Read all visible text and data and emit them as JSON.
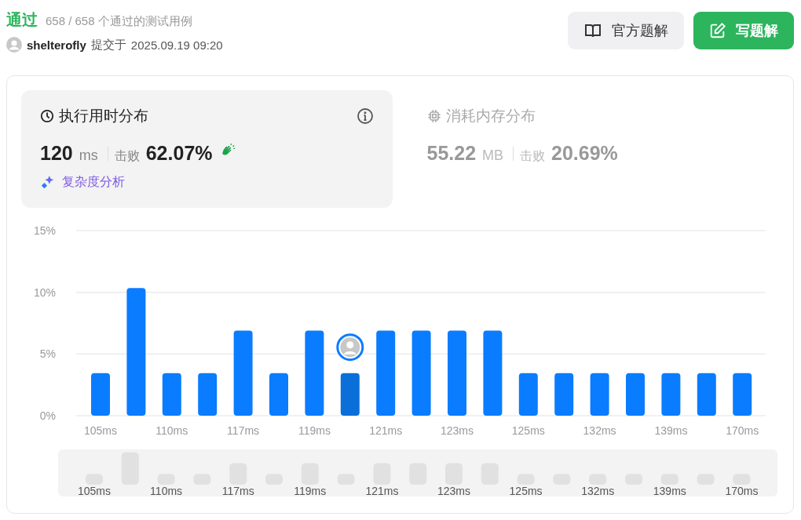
{
  "result": {
    "status": "通过",
    "cases": "658 / 658 个通过的测试用例",
    "user": "shelterofly",
    "submitted_label": "提交于",
    "submitted_at": "2025.09.19 09:20"
  },
  "buttons": [
    {
      "kind": "solution",
      "label": "官方题解"
    },
    {
      "kind": "write",
      "label": "写题解"
    }
  ],
  "panels": [
    {
      "kind": "runtime",
      "title": "执行用时分布",
      "value": "120",
      "unit": "ms",
      "beats_label": "击败",
      "beats": "62.07%",
      "selected": true,
      "link": "复杂度分析"
    },
    {
      "kind": "memory",
      "title": "消耗内存分布",
      "value": "55.22",
      "unit": "MB",
      "beats_label": "击败",
      "beats": "20.69%",
      "selected": false
    }
  ],
  "chart": {
    "bars": [
      {
        "selected": false
      },
      {
        "selected": false
      },
      {
        "selected": false
      },
      {
        "selected": false
      },
      {
        "selected": false
      },
      {
        "selected": false
      },
      {
        "selected": false
      },
      {
        "selected": true
      },
      {
        "selected": false
      },
      {
        "selected": false
      },
      {
        "selected": false
      },
      {
        "selected": false
      },
      {
        "selected": false
      },
      {
        "selected": false
      },
      {
        "selected": false
      },
      {
        "selected": false
      },
      {
        "selected": false
      },
      {
        "selected": false
      },
      {
        "selected": false
      }
    ],
    "chart_data": {
      "type": "bar",
      "categories": [
        "105ms",
        null,
        "110ms",
        null,
        "117ms",
        null,
        "119ms",
        null,
        "121ms",
        null,
        "123ms",
        null,
        "125ms",
        null,
        "132ms",
        null,
        "139ms",
        null,
        "170ms"
      ],
      "values": [
        3.45,
        10.34,
        3.45,
        3.45,
        6.9,
        3.45,
        6.9,
        3.45,
        6.9,
        6.9,
        6.9,
        6.9,
        3.45,
        3.45,
        3.45,
        3.45,
        3.45,
        3.45,
        3.45
      ],
      "ylim": [
        0,
        15
      ],
      "yticks": [
        {
          "value": 0,
          "label": "0%"
        },
        {
          "value": 5,
          "label": "5%"
        },
        {
          "value": 10,
          "label": "10%"
        },
        {
          "value": 15,
          "label": "15%"
        }
      ]
    }
  },
  "navigator": {
    "labels": [
      "105ms",
      "110ms",
      "117ms",
      "119ms",
      "121ms",
      "123ms",
      "125ms",
      "132ms",
      "139ms",
      "170ms"
    ]
  }
}
